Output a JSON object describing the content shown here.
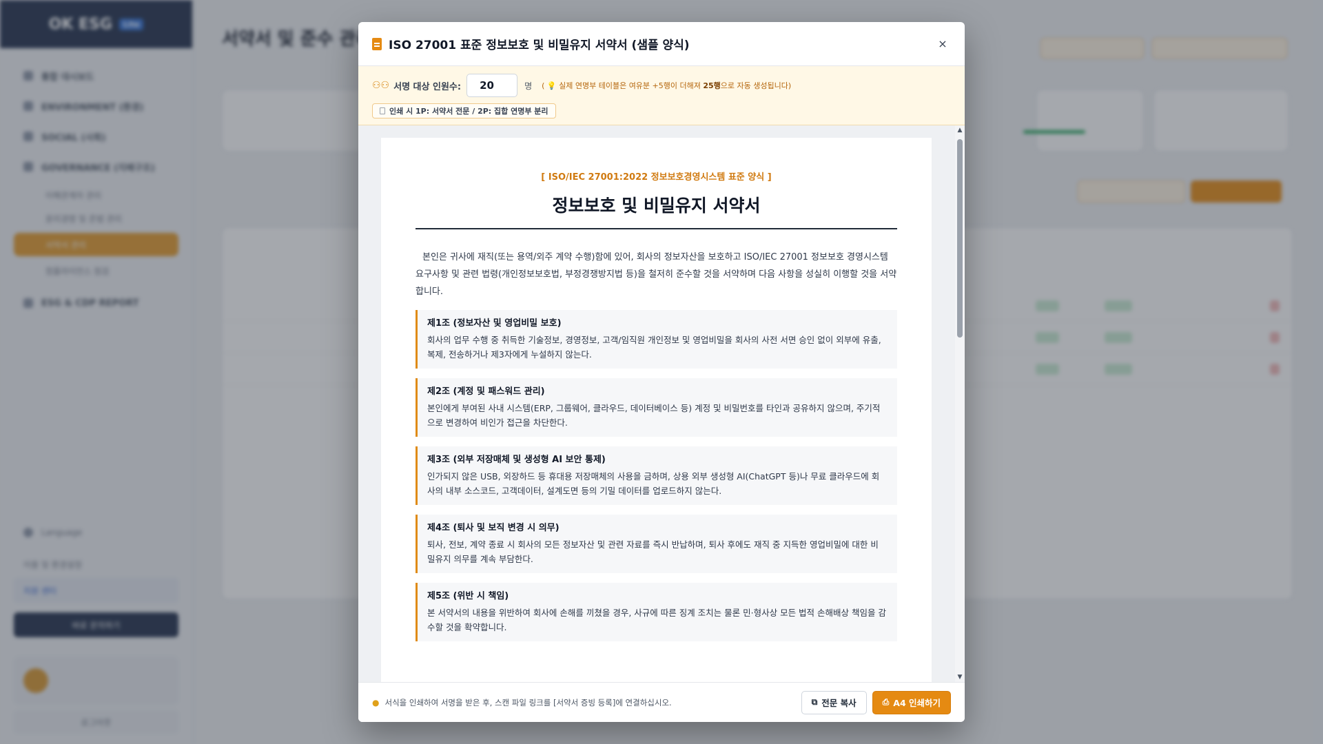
{
  "background": {
    "brand": "OK ESG",
    "brand_tag": "Lite",
    "page_title": "서약서 및 준수 관리",
    "nav": [
      "통합 대시보드",
      "ENVIRONMENT (환경)",
      "SOCIAL (사회)",
      "GOVERNANCE (지배구조)",
      "ESG & CDP REPORT"
    ],
    "nav_sub": [
      "이해관계자 관리",
      "윤리경영 및 준법 관리",
      "서약서 관리",
      "컴플라이언스 점검"
    ],
    "side_bottom": [
      "Language",
      "이용 및 환경설정",
      "지원 센터",
      "바로 문의하기"
    ],
    "logout": "로그아웃"
  },
  "modal": {
    "title": "ISO 27001 표준 정보보호 및 비밀유지 서약서 (샘플 양식)",
    "close_label": "×",
    "signers_label": "서명 대상 인원수:",
    "signers_value": "20",
    "signers_unit": "명",
    "hint_prefix": "( 💡 실제 연명부 테이블은 여유분 +5행이 더해져 ",
    "hint_bold": "25행",
    "hint_suffix": "으로 자동 생성됩니다)",
    "print_note": "인쇄 시 1P: 서약서 전문 / 2P: 집합 연명부 분리",
    "doc": {
      "standard": "[ ISO/IEC 27001:2022 정보보호경영시스템 표준 양식 ]",
      "title": "정보보호 및 비밀유지 서약서",
      "intro": "본인은 귀사에 재직(또는 용역/외주 계약 수행)함에 있어, 회사의 정보자산을 보호하고 ISO/IEC 27001 정보보호 경영시스템 요구사항 및 관련 법령(개인정보보호법, 부정경쟁방지법 등)을 철저히 준수할 것을 서약하며 다음 사항을 성실히 이행할 것을 서약합니다.",
      "articles": [
        {
          "title": "제1조 (정보자산 및 영업비밀 보호)",
          "body": "회사의 업무 수행 중 취득한 기술정보, 경영정보, 고객/임직원 개인정보 및 영업비밀을 회사의 사전 서면 승인 없이 외부에 유출, 복제, 전송하거나 제3자에게 누설하지 않는다."
        },
        {
          "title": "제2조 (계정 및 패스워드 관리)",
          "body": "본인에게 부여된 사내 시스템(ERP, 그룹웨어, 클라우드, 데이터베이스 등) 계정 및 비밀번호를 타인과 공유하지 않으며, 주기적으로 변경하여 비인가 접근을 차단한다."
        },
        {
          "title": "제3조 (외부 저장매체 및 생성형 AI 보안 통제)",
          "body": "인가되지 않은 USB, 외장하드 등 휴대용 저장매체의 사용을 금하며, 상용 외부 생성형 AI(ChatGPT 등)나 무료 클라우드에 회사의 내부 소스코드, 고객데이터, 설계도면 등의 기밀 데이터를 업로드하지 않는다."
        },
        {
          "title": "제4조 (퇴사 및 보직 변경 시 의무)",
          "body": "퇴사, 전보, 계약 종료 시 회사의 모든 정보자산 및 관련 자료를 즉시 반납하며, 퇴사 후에도 재직 중 지득한 영업비밀에 대한 비밀유지 의무를 계속 부담한다."
        },
        {
          "title": "제5조 (위반 시 책임)",
          "body": "본 서약서의 내용을 위반하여 회사에 손해를 끼쳤을 경우, 사규에 따른 징계 조치는 물론 민·형사상 모든 법적 손해배상 책임을 감수할 것을 확약합니다."
        }
      ]
    },
    "footer_note": "서식을 인쇄하여 서명을 받은 후, 스캔 파일 링크를 [서약서 증빙 등록]에 연결하십시오.",
    "copy_label": "전문 복사",
    "print_label": "A4 인쇄하기"
  },
  "colors": {
    "accent": "#e58a12",
    "overlay": "#373e4a"
  }
}
